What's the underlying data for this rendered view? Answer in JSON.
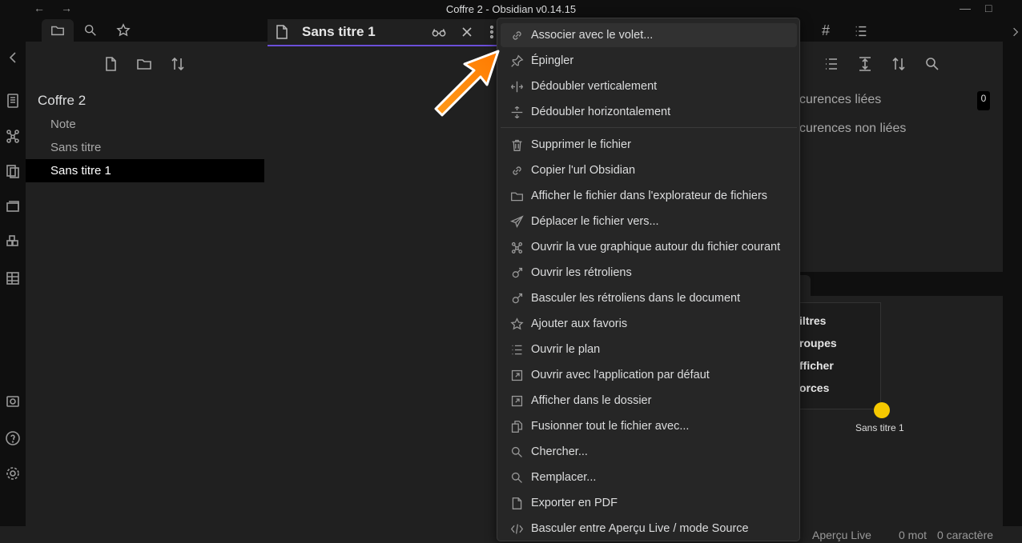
{
  "window": {
    "title": "Coffre 2 - Obsidian v0.14.15",
    "nav_back": "←",
    "nav_forward": "→",
    "minimize": "—",
    "maximize": "□"
  },
  "sidebar": {
    "vault_name": "Coffre 2",
    "files": [
      {
        "label": "Note"
      },
      {
        "label": "Sans titre"
      },
      {
        "label": "Sans titre 1"
      }
    ]
  },
  "editor": {
    "tab_title": "Sans titre 1"
  },
  "right_panel": {
    "tabs": [
      "#"
    ],
    "linked_label": "curences liées",
    "unlinked_label": "curences non liées",
    "linked_count": "0",
    "graph_options": [
      "iltres",
      "roupes",
      "fficher",
      "orces"
    ],
    "graph_node_label": "Sans titre 1",
    "graph_node_color": "#f5c800"
  },
  "menu": {
    "items": [
      {
        "label": "Associer avec le volet...",
        "icon": "link-icon"
      },
      {
        "label": "Épingler",
        "icon": "pin-icon"
      },
      {
        "label": "Dédoubler verticalement",
        "icon": "split-vertical-icon"
      },
      {
        "label": "Dédoubler horizontalement",
        "icon": "split-horizontal-icon"
      },
      {
        "label": "Supprimer le fichier",
        "icon": "trash-icon"
      },
      {
        "label": "Copier l'url Obsidian",
        "icon": "link-icon"
      },
      {
        "label": "Afficher le fichier dans l'explorateur de fichiers",
        "icon": "folder-icon"
      },
      {
        "label": "Déplacer le fichier vers...",
        "icon": "send-icon"
      },
      {
        "label": "Ouvrir la vue graphique autour du fichier courant",
        "icon": "graph-icon"
      },
      {
        "label": "Ouvrir les rétroliens",
        "icon": "backlinks-icon"
      },
      {
        "label": "Basculer les rétroliens dans le document",
        "icon": "backlinks-icon"
      },
      {
        "label": "Ajouter aux favoris",
        "icon": "star-icon"
      },
      {
        "label": "Ouvrir le plan",
        "icon": "list-icon"
      },
      {
        "label": "Ouvrir avec l'application par défaut",
        "icon": "external-icon"
      },
      {
        "label": "Afficher dans le dossier",
        "icon": "external-icon"
      },
      {
        "label": "Fusionner tout le fichier avec...",
        "icon": "merge-icon"
      },
      {
        "label": "Chercher...",
        "icon": "search-icon"
      },
      {
        "label": "Remplacer...",
        "icon": "search-icon"
      },
      {
        "label": "Exporter en PDF",
        "icon": "file-icon"
      },
      {
        "label": "Basculer entre Aperçu Live / mode Source",
        "icon": "code-icon"
      }
    ]
  },
  "statusbar": {
    "mode": "Aperçu Live",
    "words": "0 mot",
    "chars": "0 caractère"
  },
  "colors": {
    "accent": "#6b4fd8",
    "arrow": "#ff8c00"
  }
}
